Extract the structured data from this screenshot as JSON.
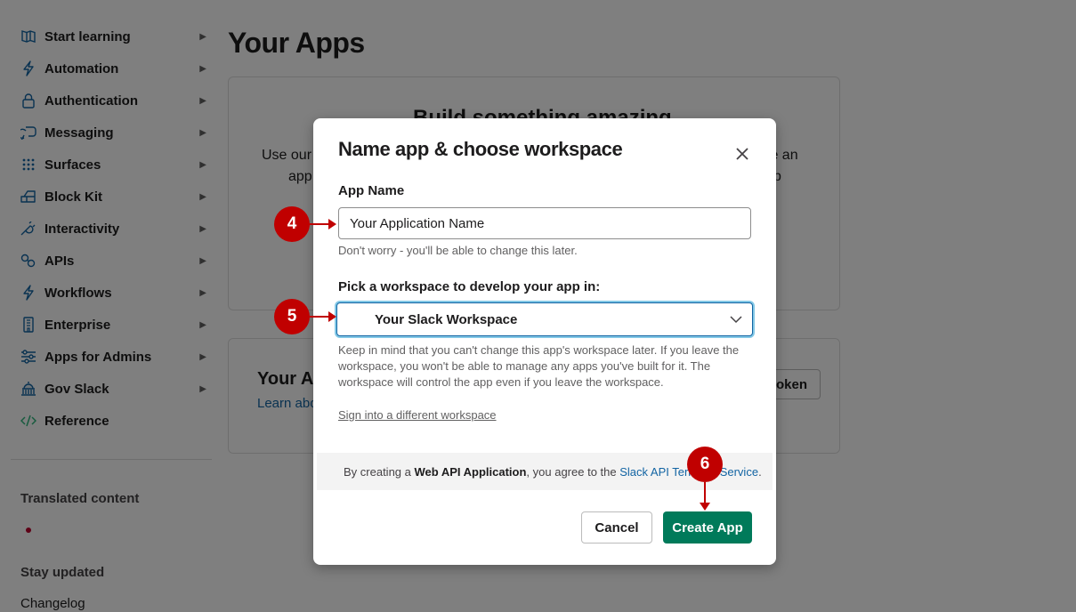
{
  "sidebar": {
    "items": [
      {
        "label": "Start learning",
        "icon": "book-icon"
      },
      {
        "label": "Automation",
        "icon": "bolt-icon"
      },
      {
        "label": "Authentication",
        "icon": "lock-icon"
      },
      {
        "label": "Messaging",
        "icon": "message-icon"
      },
      {
        "label": "Surfaces",
        "icon": "grid-icon"
      },
      {
        "label": "Block Kit",
        "icon": "blocks-icon"
      },
      {
        "label": "Interactivity",
        "icon": "plug-icon"
      },
      {
        "label": "APIs",
        "icon": "link-icon"
      },
      {
        "label": "Workflows",
        "icon": "bolt-icon"
      },
      {
        "label": "Enterprise",
        "icon": "building-icon"
      },
      {
        "label": "Apps for Admins",
        "icon": "sliders-icon"
      },
      {
        "label": "Gov Slack",
        "icon": "capitol-icon"
      },
      {
        "label": "Reference",
        "icon": "code-icon"
      }
    ],
    "translated_heading": "Translated content",
    "stay_updated_heading": "Stay updated",
    "changelog_label": "Changelog"
  },
  "page": {
    "title": "Your Apps",
    "card1_heading": "Build something amazing.",
    "card1_text_left_1": "Use our",
    "card1_text_left_2": "app",
    "card1_text_right_1": "te an",
    "card1_text_right_2": "p",
    "card2_heading": "Your Ap",
    "card2_link": "Learn abo",
    "card2_button": "oken"
  },
  "modal": {
    "title": "Name app & choose workspace",
    "app_name_label": "App Name",
    "app_name_value": "Your Application Name",
    "app_name_hint": "Don't worry - you'll be able to change this later.",
    "workspace_label": "Pick a workspace to develop your app in:",
    "workspace_value": "Your Slack Workspace",
    "workspace_warning": "Keep in mind that you can't change this app's workspace later. If you leave the workspace, you won't be able to manage any apps you've built for it. The workspace will control the app even if you leave the workspace.",
    "sign_in_link": "Sign into a different workspace",
    "terms_prefix": "By creating a",
    "terms_bold": "Web API Application",
    "terms_middle": ", you agree to the",
    "terms_link": "Slack API Terms of Service",
    "terms_suffix": ".",
    "cancel_label": "Cancel",
    "create_label": "Create App"
  },
  "callouts": {
    "step4": "4",
    "step5": "5",
    "step6": "6"
  },
  "colors": {
    "callout": "#c00000",
    "create_button": "#007a5a",
    "link": "#1264a3"
  }
}
